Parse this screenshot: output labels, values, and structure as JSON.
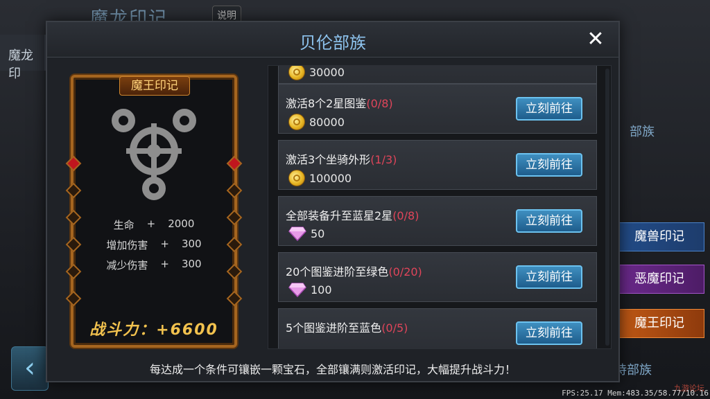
{
  "background": {
    "title": "魔龙印记",
    "help_label": "说明",
    "left_tab": "魔龙印",
    "right_label": "部族",
    "side_tabs": [
      "魔兽印记",
      "恶魔印记",
      "魔王印记"
    ],
    "right_label_bottom": "诗部族",
    "watermark": "九游论坛",
    "fps_text": "FPS:25.17  Mem:483.35/58.77/10.16"
  },
  "modal": {
    "title": "贝伦部族",
    "footer_tip": "每达成一个条件可镶嵌一颗宝石，全部镶满则激活印记，大幅提升战斗力！"
  },
  "card": {
    "title": "魔王印记",
    "stats": [
      {
        "name": "生命",
        "op": "+",
        "value": "2000"
      },
      {
        "name": "增加伤害",
        "op": "+",
        "value": "300"
      },
      {
        "name": "减少伤害",
        "op": "+",
        "value": "300"
      }
    ],
    "power": "战斗力：+6600"
  },
  "tasks": [
    {
      "text": "",
      "progress": "",
      "reward_type": "coin",
      "reward": "30000",
      "button": ""
    },
    {
      "text": "激活8个2星图鉴",
      "progress": "(0/8)",
      "reward_type": "coin",
      "reward": "80000",
      "button": "立刻前往"
    },
    {
      "text": "激活3个坐骑外形",
      "progress": "(1/3)",
      "reward_type": "coin",
      "reward": "100000",
      "button": "立刻前往"
    },
    {
      "text": "全部装备升至蓝星2星",
      "progress": "(0/8)",
      "reward_type": "gem",
      "reward": "50",
      "button": "立刻前往"
    },
    {
      "text": "20个图鉴进阶至绿色",
      "progress": "(0/20)",
      "reward_type": "gem",
      "reward": "100",
      "button": "立刻前往"
    },
    {
      "text": "5个图鉴进阶至蓝色",
      "progress": "(0/5)",
      "reward_type": "gem",
      "reward": "",
      "button": "立刻前往"
    }
  ],
  "colors": {
    "accent": "#8ec4ef",
    "progress": "#e0455a",
    "frame": "#a5651f",
    "power": "#f2c24e"
  }
}
